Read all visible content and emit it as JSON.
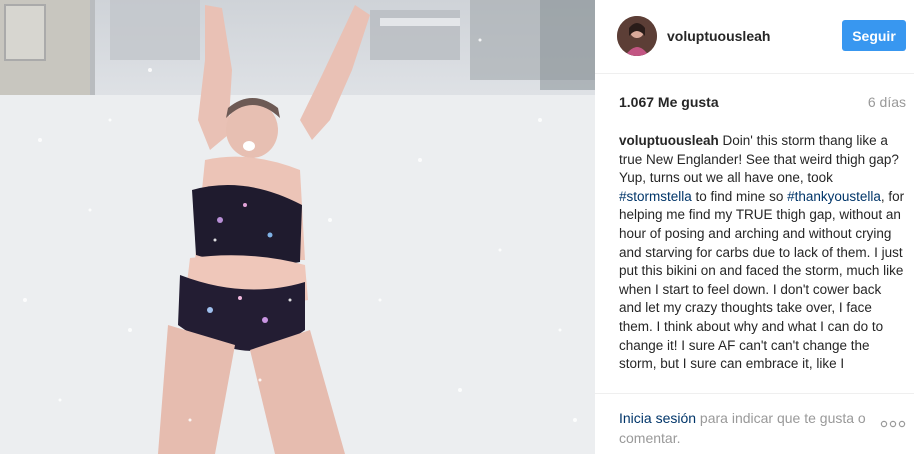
{
  "post": {
    "photo_icon": "photo-person-in-snow",
    "author": {
      "username": "voluptuousleah",
      "avatar_icon": "profile-avatar"
    },
    "follow_label": "Seguir",
    "likes_text": "1.067 Me gusta",
    "time_text": "6 días",
    "caption": {
      "username": "voluptuousleah",
      "text_1": "Doin' this storm thang like a true New Englander! See that weird thigh gap? Yup, turns out we all have one, took ",
      "tag_1": "#stormstella",
      "text_2": " to find mine so ",
      "tag_2": "#thankyoustella",
      "text_3": ", for helping me find my TRUE thigh gap, without an hour of posing and arching and without crying and starving for carbs due to lack of them. I just put this bikini on and faced the storm, much like when I start to feel down. I don't cower back and let my crazy thoughts take over, I face them. I think about why and what I can do to change it! I sure AF can't can't change the storm, but I sure can embrace it, like I"
    },
    "footer": {
      "login_link": "Inicia sesión",
      "login_rest": " para indicar que te gusta o comentar.",
      "more_icon": "more-options-icon"
    },
    "colors": {
      "follow_button": "#3897f0",
      "hashtag": "#003569",
      "muted": "#999999"
    }
  }
}
